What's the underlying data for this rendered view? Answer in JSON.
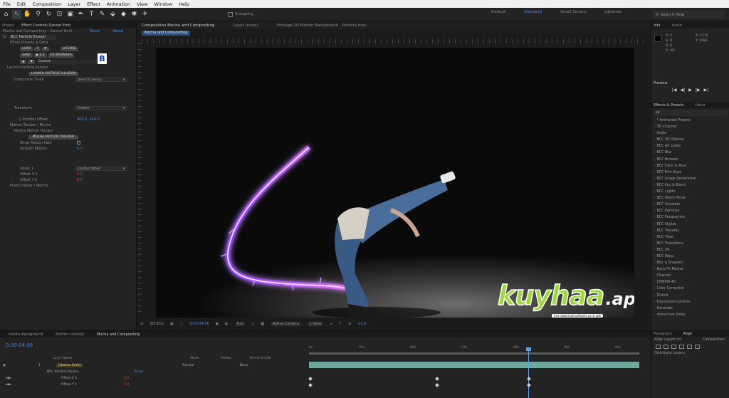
{
  "menu": [
    "File",
    "Edit",
    "Composition",
    "Layer",
    "Effect",
    "Animation",
    "View",
    "Window",
    "Help"
  ],
  "toolbar": {
    "tools": [
      "⌂",
      "↖",
      "✋",
      "⚲",
      "↻",
      "⊡",
      "▣",
      "✒",
      "T",
      "✎",
      "⬙",
      "◆",
      "✱",
      "✈"
    ],
    "snapping": "Snapping",
    "workspaces": [
      "Default",
      "Standard",
      "Small Screen",
      "Libraries"
    ],
    "active_workspace": "Standard",
    "search_placeholder": "Search Help"
  },
  "left_panel": {
    "tabs": [
      "Project",
      "Effect Controls Dancer Emit"
    ],
    "crumb": "Mocha and Compositing • Dancer Emit",
    "crumb_links": [
      "Reset",
      "About"
    ],
    "effect_name": "BCC Particle Illusion",
    "pin_label": "Effect Presets & Data",
    "buttons_row1": [
      "LOAD",
      "?",
      "⚙",
      "LICENSE"
    ],
    "buttons_row2": [
      "SAVE",
      "▶ S.E",
      "FX BROWSER"
    ],
    "buttons_row3": [
      "▲",
      "▼",
      "Current"
    ],
    "launch_group": "Launch Particle Illusion",
    "launch_button": "LAUNCH PARTICLE ILLUSION",
    "composite_label": "Composite Track",
    "composite_value": "Direct (Classic)",
    "transform_label": "Transform",
    "transform_value": "Emitter",
    "emitter_offset_label": "Emitter Offset",
    "emitter_offset_value": "960.0, 540.0",
    "motion_tracker_label": "Motion Tracker / Mocha",
    "mocha_tracker_label": "Mocha Motion Tracker",
    "mocha_button": "MOCHA MOTION TRACKER",
    "show_path_label": "Show Motion Path",
    "smooth_label": "Smooth Motion",
    "smooth_value": "0.0",
    "apply_label": "Apply 1",
    "apply_value": "Emitter Offset",
    "offset_x_label": "Offset X 1",
    "offset_x_value": "0.0",
    "offset_y_label": "Offset Y 1",
    "offset_y_value": "0.0",
    "pixel_chooser_label": "PixelChooser / Mocha"
  },
  "viewer": {
    "tabs": [
      "Composition Mocha and Compositing",
      "Layer (none)",
      "Footage 3D Motion Background - Particle.mov"
    ],
    "subtab": "Mocha and Compositing",
    "zoom": "(63.6%)",
    "timecode": "0:00:04:06",
    "resolution": "Full",
    "camera": "Active Camera",
    "views": "1 View",
    "exposure": "+0.0"
  },
  "watermark": {
    "brand": "kuyhaa",
    "tld": ".app",
    "tagline": "free download software pc & apk"
  },
  "right_panel": {
    "tabs": [
      "Info",
      "Audio"
    ],
    "info_r": "R: 0",
    "info_g": "G: 0",
    "info_b": "B: 0",
    "info_a": "A: 0%",
    "info_x": "X: 1774",
    "info_y": "Y: 1983",
    "preview_title": "Preview",
    "preview_controls": [
      "|◀",
      "◀|",
      "▶",
      "|▶",
      "▶|"
    ],
    "effects_tabs": [
      "Effects & Presets",
      "Librar"
    ],
    "effects_search": "ρ▾",
    "effects": [
      "* Animation Presets",
      "3D Channel",
      "Audio",
      "BCC 3D Objects",
      "BCC Art Looks",
      "BCC Blur",
      "BCC Browser",
      "BCC Color & Tone",
      "BCC Film Style",
      "BCC Image Restoration",
      "BCC Key & Blend",
      "BCC Lights",
      "BCC Match Move",
      "BCC Obsolete",
      "BCC Particles",
      "BCC Perspective",
      "BCC Stylize",
      "BCC Textures",
      "BCC Time",
      "BCC Transitions",
      "BCC VR",
      "BCC Warp",
      "Blur & Sharpen",
      "Boris FX Mocha",
      "Channel",
      "CINEMA 4D",
      "Color Correction",
      "Distort",
      "Expression Controls",
      "Generate",
      "Immersive Video"
    ]
  },
  "timeline": {
    "tabs": [
      "mocha background",
      "Emitter controls",
      "Mocha and Compositing"
    ],
    "timecode": "0:00:04:06",
    "col_source": "Layer Name",
    "col_mode": "Mode",
    "col_trkmat": "TrkMat",
    "col_parent": "Parent & Link",
    "layer_num": "1",
    "layer_name": "[Dancer Emit]",
    "layer_mode": "Normal",
    "parent_value": "None",
    "fx_row": "BCC Particle Illusion",
    "fx_reset": "Reset",
    "offx_label": "Offset X 1",
    "offx_value": "0.0",
    "offy_label": "Offset Y 1",
    "offy_value": "0.0",
    "ruler": [
      "0s",
      "01s",
      "02s",
      "03s",
      "04s",
      "05s",
      "06s"
    ]
  },
  "align_panel": {
    "tabs": [
      "Paragraph",
      "Align"
    ],
    "align_layers_to": "Align Layers to:",
    "align_target": "Composition",
    "distribute": "Distribute Layers:"
  }
}
